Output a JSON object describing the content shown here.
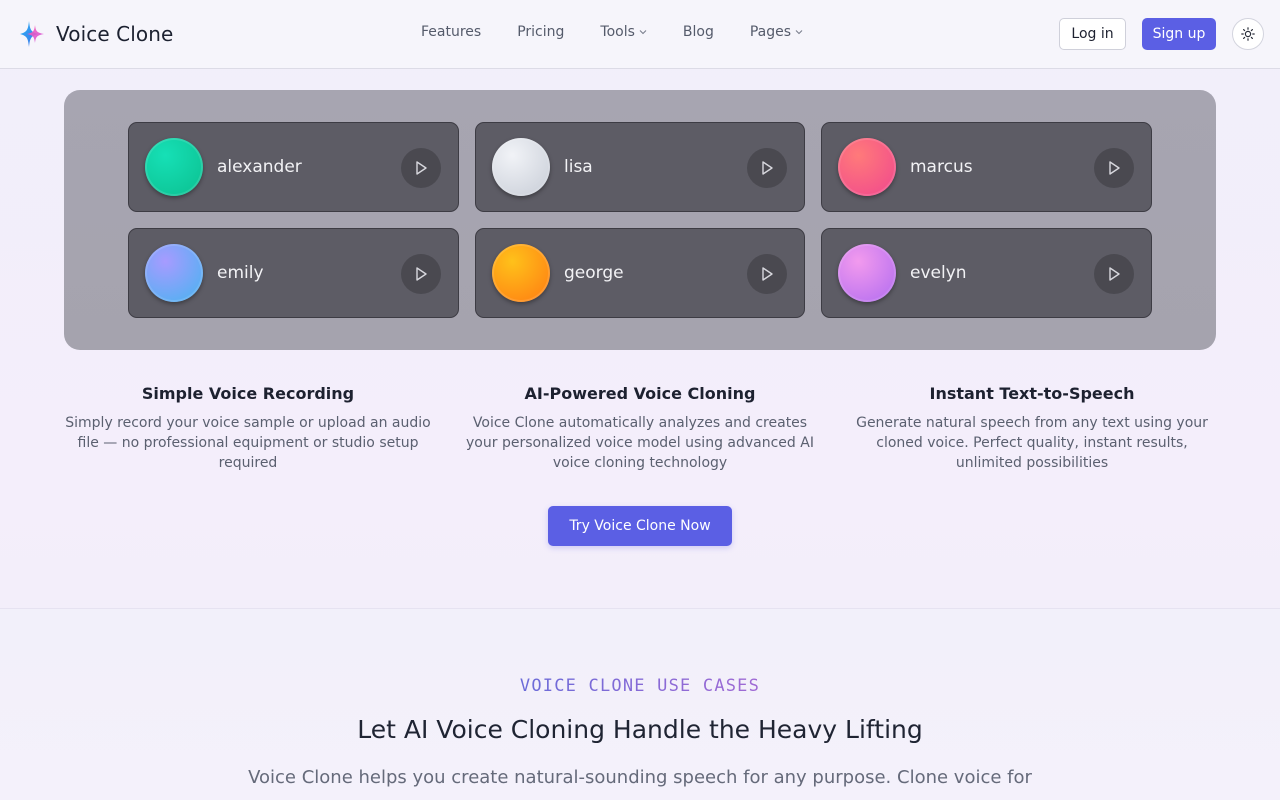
{
  "header": {
    "brand": "Voice Clone",
    "nav": [
      {
        "label": "Features",
        "dropdown": false
      },
      {
        "label": "Pricing",
        "dropdown": false
      },
      {
        "label": "Tools",
        "dropdown": true
      },
      {
        "label": "Blog",
        "dropdown": false
      },
      {
        "label": "Pages",
        "dropdown": true
      }
    ],
    "login_label": "Log in",
    "signup_label": "Sign up",
    "theme_icon": "sun-icon"
  },
  "voices": [
    {
      "name": "alexander",
      "gradient": [
        "#16e0b6",
        "#0bbf8f"
      ]
    },
    {
      "name": "lisa",
      "gradient": [
        "#f1f3f7",
        "#c7ccd6"
      ]
    },
    {
      "name": "marcus",
      "gradient": [
        "#ff7a7a",
        "#f0468e"
      ]
    },
    {
      "name": "emily",
      "gradient": [
        "#a79bff",
        "#45b4f0"
      ]
    },
    {
      "name": "george",
      "gradient": [
        "#ffc11a",
        "#ff7a12"
      ]
    },
    {
      "name": "evelyn",
      "gradient": [
        "#f29aee",
        "#b06bf0"
      ]
    }
  ],
  "features": [
    {
      "title": "Simple Voice Recording",
      "desc": "Simply record your voice sample or upload an audio file — no professional equipment or studio setup required"
    },
    {
      "title": "AI-Powered Voice Cloning",
      "desc": "Voice Clone automatically analyzes and creates your personalized voice model using advanced AI voice cloning technology"
    },
    {
      "title": "Instant Text-to-Speech",
      "desc": "Generate natural speech from any text using your cloned voice. Perfect quality, instant results, unlimited possibilities"
    }
  ],
  "cta_label": "Try Voice Clone Now",
  "use_cases": {
    "eyebrow": "VOICE CLONE USE CASES",
    "title": "Let AI Voice Cloning Handle the Heavy Lifting",
    "desc": "Voice Clone helps you create natural-sounding speech for any purpose. Clone voice for"
  },
  "colors": {
    "accent": "#5b5fe4",
    "panel": "#a7a5b1",
    "card": "#5d5c65"
  }
}
